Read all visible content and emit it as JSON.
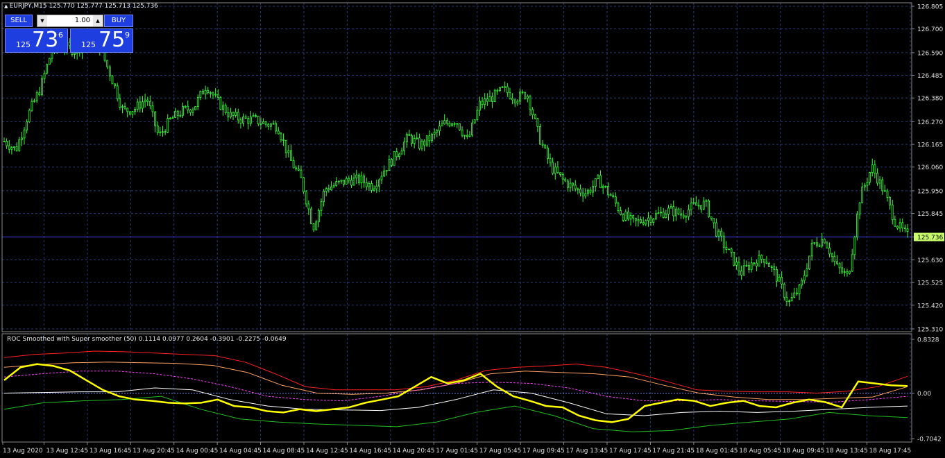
{
  "main_chart": {
    "header": "EURJPY,M15  125.770 125.777 125.713 125.736",
    "price_ticks": [
      "126.805",
      "126.700",
      "126.590",
      "126.485",
      "126.380",
      "126.270",
      "126.165",
      "126.060",
      "125.950",
      "125.845",
      "125.736",
      "125.630",
      "125.525",
      "125.420",
      "125.310"
    ],
    "current_price": "125.736",
    "colors": {
      "candles": "#32ff32",
      "grid": "#2a3a78",
      "axis": "#8a8a8a",
      "price_line": "#3a3aff",
      "price_tag_bg": "#c9ff6a"
    }
  },
  "trade_panel": {
    "sell_label": "SELL",
    "buy_label": "BUY",
    "lot_value": "1.00",
    "sell_price": {
      "prefix": "125",
      "big": "73",
      "sup": "6"
    },
    "buy_price": {
      "prefix": "125",
      "big": "75",
      "sup": "9"
    }
  },
  "indicator": {
    "header": "ROC Smoothed with Super smoother (50) 0.1114 0.0977 0.2604 -0.3901 -0.2275 -0.0649",
    "ticks": [
      "0.8328",
      "0.00",
      "-0.7042"
    ],
    "colors": {
      "roc": "#ffff00",
      "upper": "#ff2020",
      "upper_mid": "#ffa060",
      "mid": "#ff40ff",
      "lower_mid": "#ffffff",
      "lower": "#20c020",
      "zero": "#6a8aff"
    }
  },
  "time_axis": {
    "labels": [
      "13 Aug 2020",
      "13 Aug 12:45",
      "13 Aug 16:45",
      "13 Aug 20:45",
      "14 Aug 00:45",
      "14 Aug 04:45",
      "14 Aug 08:45",
      "14 Aug 12:45",
      "14 Aug 16:45",
      "14 Aug 20:45",
      "17 Aug 01:45",
      "17 Aug 05:45",
      "17 Aug 09:45",
      "17 Aug 13:45",
      "17 Aug 17:45",
      "17 Aug 21:45",
      "18 Aug 01:45",
      "18 Aug 05:45",
      "18 Aug 09:45",
      "18 Aug 13:45",
      "18 Aug 17:45"
    ]
  },
  "chart_data": {
    "type": "line",
    "series": [
      {
        "values": [
          126.18,
          126.14,
          126.3,
          126.42,
          126.6,
          126.62,
          126.6,
          126.64,
          126.62,
          126.48,
          126.32,
          126.33,
          126.38,
          126.2,
          126.28,
          126.32,
          126.34,
          126.44,
          126.36,
          126.3,
          126.28,
          126.28,
          126.26,
          126.25,
          126.1,
          126.0,
          125.78,
          125.96,
          125.98,
          126.0,
          126.0,
          125.97,
          126.05,
          126.12,
          126.2,
          126.16,
          126.2,
          126.26,
          126.28,
          126.18,
          126.35,
          126.38,
          126.42,
          126.38,
          126.4,
          126.2,
          126.06,
          126.0,
          125.96,
          125.94,
          126.0,
          125.93,
          125.84,
          125.8,
          125.82,
          125.84,
          125.86,
          125.84,
          125.88,
          125.89,
          125.75,
          125.66,
          125.57,
          125.62,
          125.64,
          125.55,
          125.43,
          125.5,
          125.7,
          125.73,
          125.6,
          125.55,
          125.92,
          126.06,
          125.95,
          125.8,
          125.74
        ]
      }
    ],
    "ylim": [
      125.31,
      126.805
    ]
  },
  "indicator_data": {
    "ylim": [
      -0.7042,
      0.8328
    ],
    "roc": [
      0.2,
      0.4,
      0.45,
      0.42,
      0.35,
      0.2,
      0.05,
      -0.05,
      -0.1,
      -0.12,
      -0.15,
      -0.16,
      -0.15,
      -0.1,
      -0.2,
      -0.22,
      -0.28,
      -0.3,
      -0.25,
      -0.28,
      -0.25,
      -0.22,
      -0.15,
      -0.1,
      -0.05,
      0.1,
      0.25,
      0.15,
      0.2,
      0.3,
      0.1,
      -0.05,
      -0.12,
      -0.2,
      -0.22,
      -0.35,
      -0.42,
      -0.45,
      -0.4,
      -0.2,
      -0.15,
      -0.1,
      -0.12,
      -0.2,
      -0.15,
      -0.12,
      -0.2,
      -0.22,
      -0.15,
      -0.1,
      -0.14,
      -0.22,
      0.18,
      0.15,
      0.12,
      0.11
    ],
    "upper": [
      0.55,
      0.6,
      0.62,
      0.65,
      0.64,
      0.62,
      0.6,
      0.58,
      0.48,
      0.3,
      0.1,
      0.05,
      0.05,
      0.05,
      0.1,
      0.2,
      0.35,
      0.4,
      0.42,
      0.45,
      0.4,
      0.3,
      0.18,
      0.05,
      0.03,
      0.02,
      0.02,
      0.0,
      0.03,
      0.1,
      0.26
    ],
    "upper_mid": [
      0.4,
      0.44,
      0.47,
      0.48,
      0.47,
      0.46,
      0.43,
      0.32,
      0.12,
      0.0,
      -0.02,
      0.0,
      0.05,
      0.15,
      0.3,
      0.34,
      0.32,
      0.3,
      0.25,
      0.12,
      0.0,
      -0.06,
      -0.1,
      -0.1,
      -0.08,
      -0.06,
      0.1
    ],
    "mid": [
      0.25,
      0.3,
      0.34,
      0.34,
      0.3,
      0.22,
      0.1,
      -0.05,
      -0.1,
      -0.12,
      -0.05,
      0.05,
      0.15,
      0.17,
      0.15,
      0.08,
      -0.05,
      -0.12,
      -0.12,
      -0.1,
      -0.12,
      -0.13,
      -0.14,
      -0.1,
      -0.05
    ],
    "lower_mid": [
      0.0,
      0.01,
      0.02,
      0.02,
      0.08,
      0.05,
      -0.1,
      -0.2,
      -0.25,
      -0.26,
      -0.27,
      -0.22,
      -0.1,
      0.05,
      0.0,
      -0.15,
      -0.32,
      -0.35,
      -0.3,
      -0.28,
      -0.3,
      -0.28,
      -0.25,
      -0.22,
      -0.2
    ],
    "lower": [
      -0.25,
      -0.15,
      -0.12,
      -0.1,
      -0.05,
      -0.25,
      -0.4,
      -0.45,
      -0.48,
      -0.5,
      -0.52,
      -0.45,
      -0.3,
      -0.2,
      -0.35,
      -0.55,
      -0.6,
      -0.58,
      -0.5,
      -0.45,
      -0.4,
      -0.3,
      -0.35,
      -0.38
    ]
  }
}
